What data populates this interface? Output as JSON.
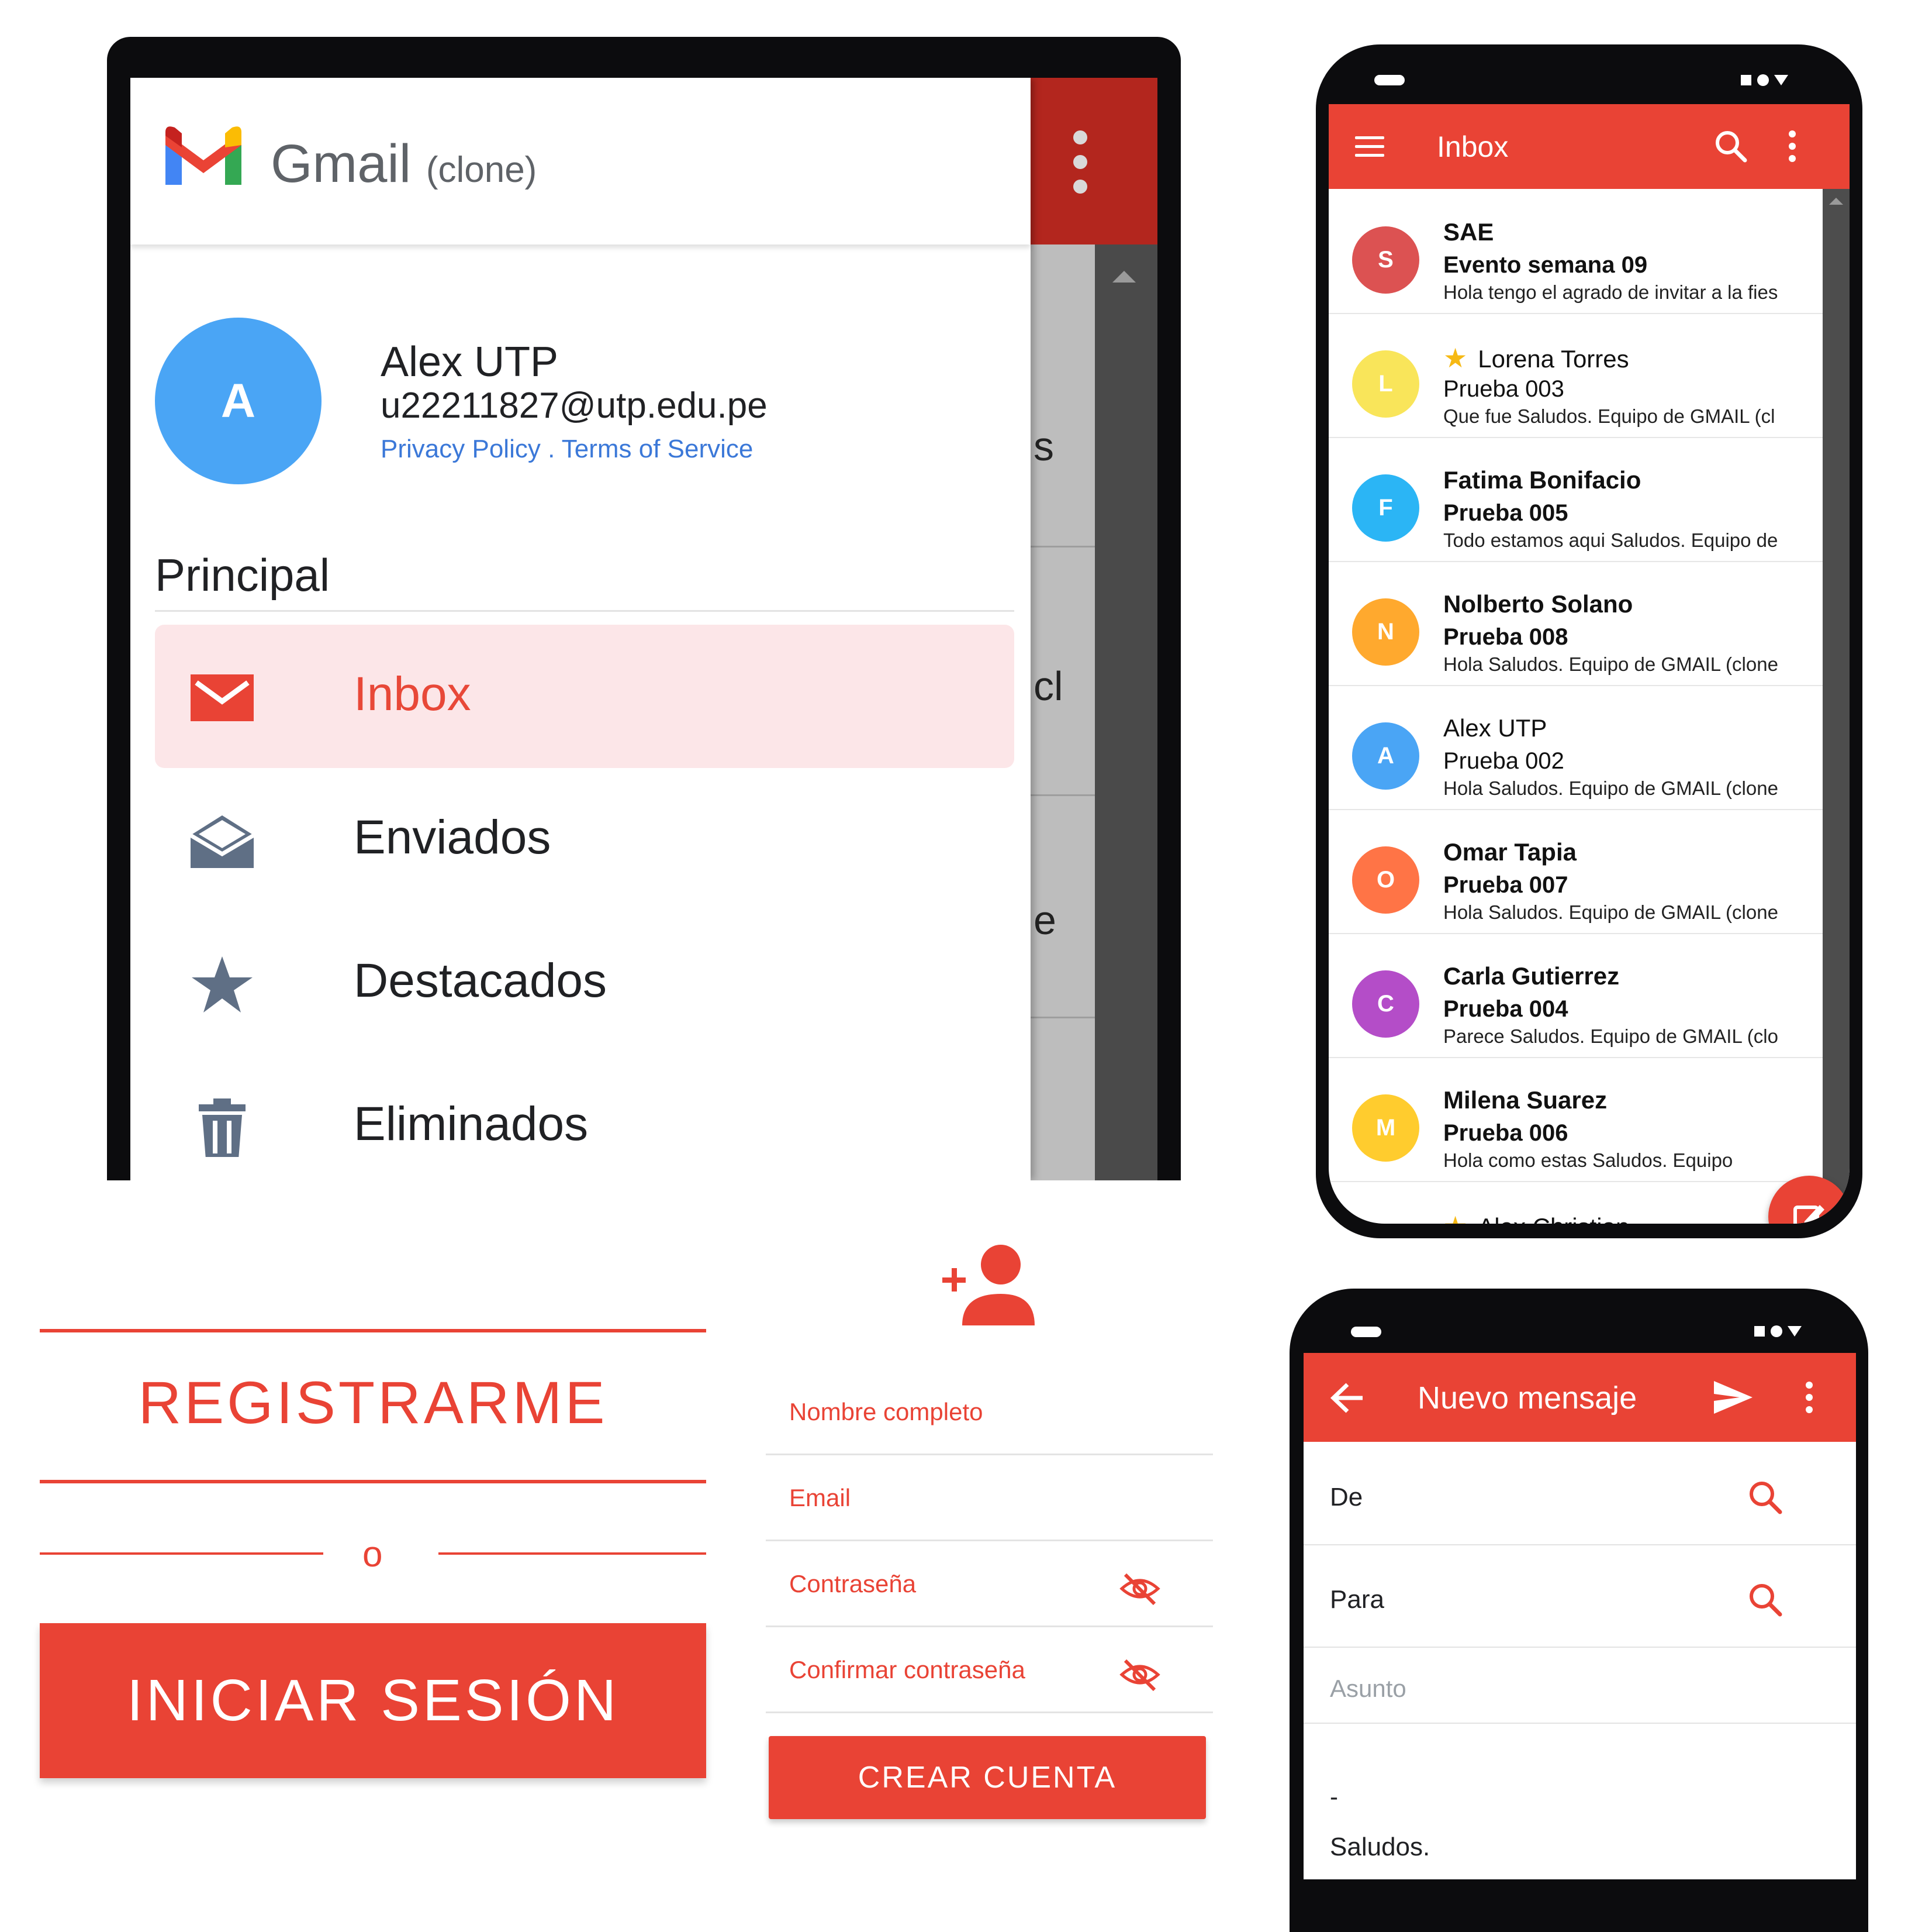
{
  "drawer": {
    "app_name": "Gmail",
    "app_suffix": "(clone)",
    "user": {
      "initial": "A",
      "name": "Alex UTP",
      "email": "u22211827@utp.edu.pe",
      "privacy": "Privacy Policy",
      "separator": " . ",
      "terms": "Terms of Service"
    },
    "section": "Principal",
    "items": [
      {
        "label": "Inbox",
        "icon": "mail-icon",
        "active": true
      },
      {
        "label": "Enviados",
        "icon": "open-mail-icon",
        "active": false
      },
      {
        "label": "Destacados",
        "icon": "star-icon",
        "active": false
      },
      {
        "label": "Eliminados",
        "icon": "trash-icon",
        "active": false
      }
    ],
    "behind_fragments": [
      "s",
      "cl",
      "e"
    ]
  },
  "inbox": {
    "title": "Inbox",
    "messages": [
      {
        "initial": "S",
        "color": "#dc5252",
        "from": "SAE",
        "subject": "Evento semana 09",
        "preview": "Hola tengo el agrado de invitar a la fies",
        "unread": true,
        "starred": false
      },
      {
        "initial": "L",
        "color": "#f9e55a",
        "from": "Lorena Torres",
        "subject": "Prueba 003",
        "preview": "Que fue Saludos. Equipo de GMAIL (cl",
        "unread": false,
        "starred": true
      },
      {
        "initial": "F",
        "color": "#2bb5f5",
        "from": "Fatima Bonifacio",
        "subject": "Prueba 005",
        "preview": "Todo estamos aqui Saludos. Equipo de",
        "unread": true,
        "starred": false
      },
      {
        "initial": "N",
        "color": "#ffa92e",
        "from": "Nolberto Solano",
        "subject": "Prueba 008",
        "preview": "Hola Saludos. Equipo de GMAIL (clone",
        "unread": true,
        "starred": false
      },
      {
        "initial": "A",
        "color": "#4aa5f5",
        "from": "Alex UTP",
        "subject": "Prueba 002",
        "preview": "Hola Saludos. Equipo de GMAIL (clone",
        "unread": false,
        "starred": false
      },
      {
        "initial": "O",
        "color": "#ff7446",
        "from": "Omar Tapia",
        "subject": "Prueba 007",
        "preview": "Hola Saludos. Equipo de GMAIL (clone",
        "unread": true,
        "starred": false
      },
      {
        "initial": "C",
        "color": "#b44dc8",
        "from": "Carla Gutierrez",
        "subject": "Prueba 004",
        "preview": "Parece Saludos. Equipo de GMAIL (clo",
        "unread": true,
        "starred": false
      },
      {
        "initial": "M",
        "color": "#ffcc2e",
        "from": "Milena Suarez",
        "subject": "Prueba 006",
        "preview": "Hola como estas Saludos. Equipo",
        "unread": true,
        "starred": false
      }
    ],
    "partial_row": "Alex Christian"
  },
  "auth": {
    "register": "REGISTRARME",
    "or": "o",
    "login": "INICIAR SESIÓN"
  },
  "signup": {
    "fields": [
      {
        "label": "Nombre completo",
        "has_eye": false
      },
      {
        "label": "Email",
        "has_eye": false
      },
      {
        "label": "Contraseña",
        "has_eye": true
      },
      {
        "label": "Confirmar contraseña",
        "has_eye": true
      }
    ],
    "submit": "CREAR CUENTA"
  },
  "compose": {
    "title": "Nuevo mensaje",
    "from_label": "De",
    "to_label": "Para",
    "subject_placeholder": "Asunto",
    "body_line1": "-",
    "body_line2": "Saludos."
  },
  "colors": {
    "brand_red": "#e94335",
    "active_bg": "#fce6e8",
    "link_blue": "#3b78d8"
  }
}
